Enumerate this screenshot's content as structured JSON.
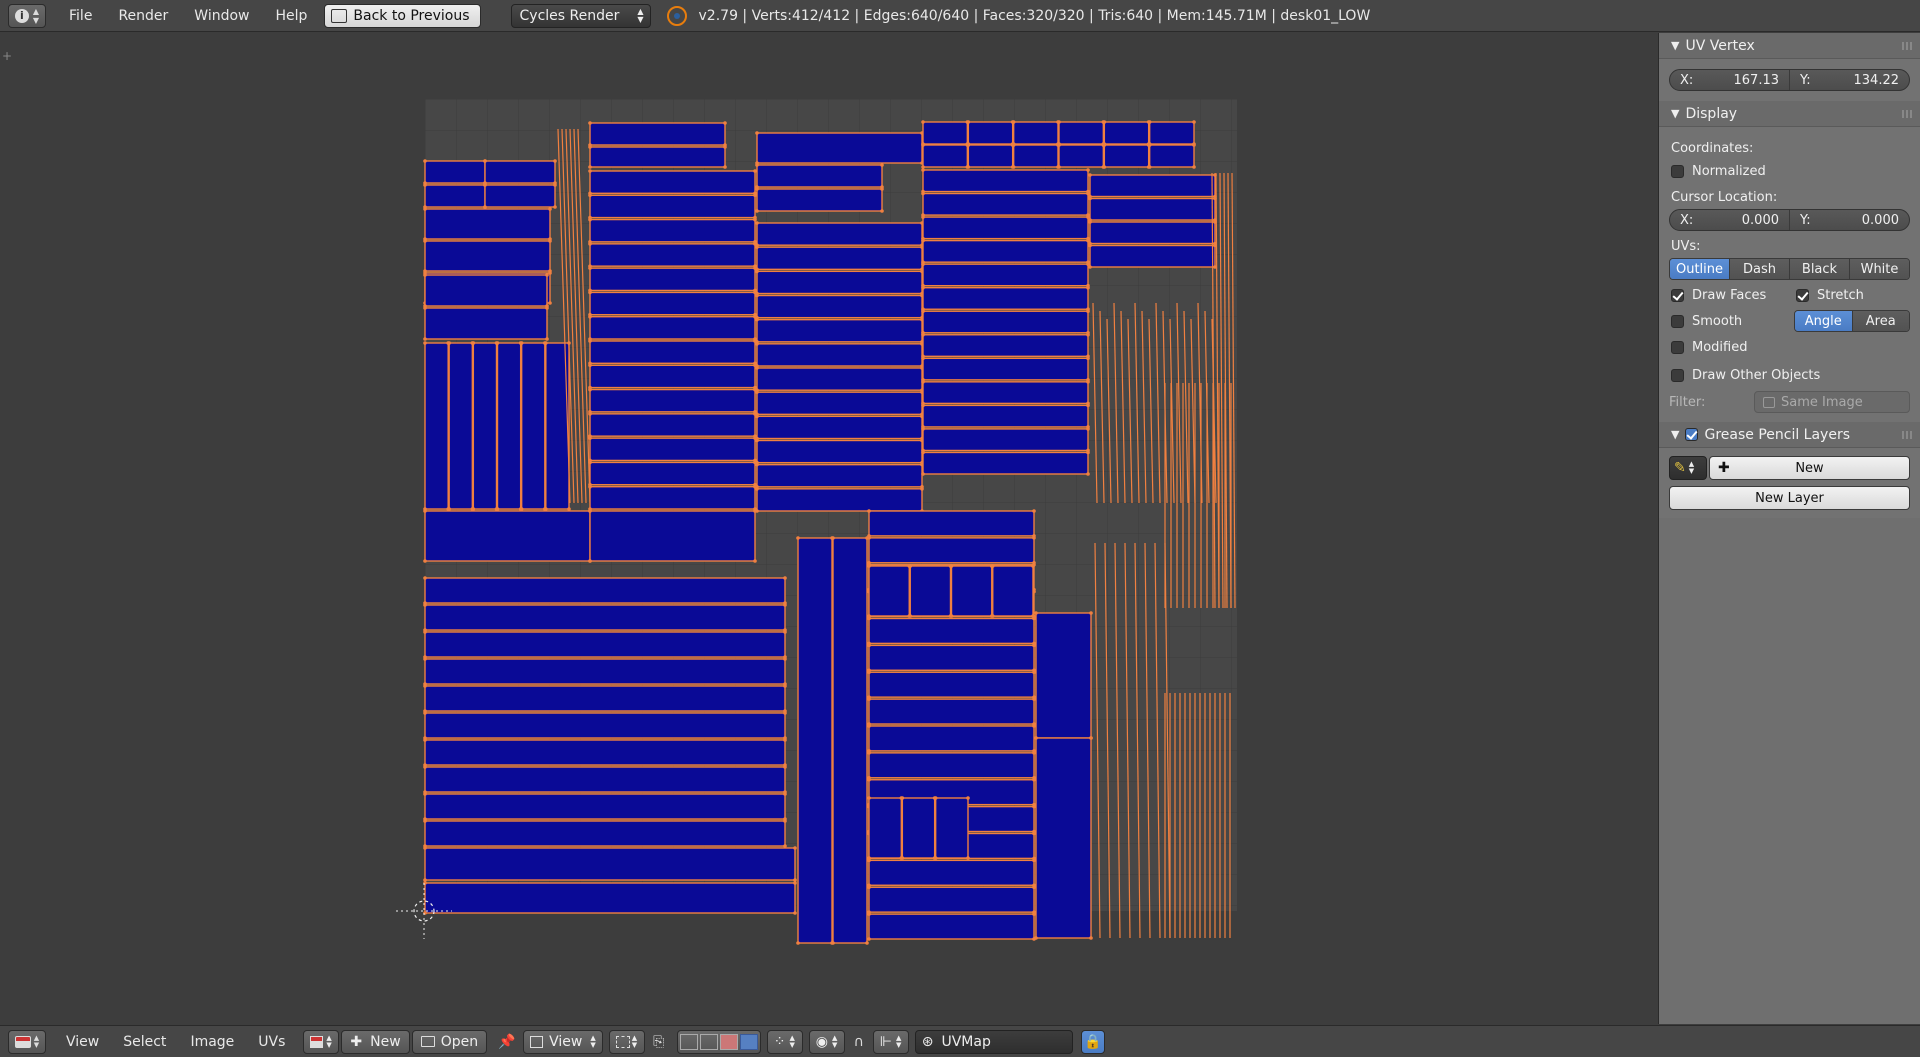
{
  "topbar": {
    "menus": [
      "File",
      "Render",
      "Window",
      "Help"
    ],
    "back_label": "Back to Previous",
    "engine": "Cycles Render",
    "status": "v2.79 | Verts:412/412 | Edges:640/640 | Faces:320/320 | Tris:640 | Mem:145.71M | desk01_LOW"
  },
  "panel": {
    "uv_vertex": {
      "title": "UV Vertex",
      "x_label": "X:",
      "x_value": "167.13",
      "y_label": "Y:",
      "y_value": "134.22"
    },
    "display": {
      "title": "Display",
      "coordinates_label": "Coordinates:",
      "normalized_label": "Normalized",
      "normalized_checked": false,
      "cursor_label": "Cursor Location:",
      "cursor_x_label": "X:",
      "cursor_x": "0.000",
      "cursor_y_label": "Y:",
      "cursor_y": "0.000",
      "uvs_label": "UVs:",
      "uv_modes": [
        "Outline",
        "Dash",
        "Black",
        "White"
      ],
      "uv_mode_active": "Outline",
      "draw_faces_label": "Draw Faces",
      "draw_faces_checked": true,
      "stretch_label": "Stretch",
      "stretch_checked": true,
      "smooth_label": "Smooth",
      "smooth_checked": false,
      "stretch_modes": [
        "Angle",
        "Area"
      ],
      "stretch_mode_active": "Angle",
      "modified_label": "Modified",
      "modified_checked": false,
      "draw_other_label": "Draw Other Objects",
      "draw_other_checked": false,
      "filter_label": "Filter:",
      "filter_value": "Same Image"
    },
    "grease": {
      "title": "Grease Pencil Layers",
      "new_label": "New",
      "new_layer_label": "New Layer"
    }
  },
  "bottombar": {
    "menus": [
      "View",
      "Select",
      "Image",
      "UVs"
    ],
    "new_label": "New",
    "open_label": "Open",
    "view_label": "View",
    "uvmap_label": "UVMap"
  },
  "colors": {
    "face_fill": "#0a0a96",
    "edge": "#f08040",
    "grid_bg": "#474747",
    "accent": "#5680c2"
  }
}
